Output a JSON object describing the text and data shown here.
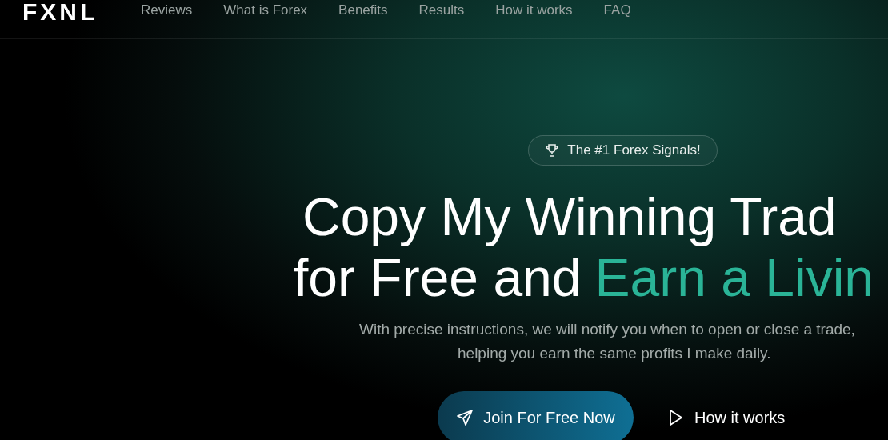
{
  "header": {
    "logo": "FXNL",
    "nav": [
      {
        "label": "Reviews"
      },
      {
        "label": "What is Forex"
      },
      {
        "label": "Benefits"
      },
      {
        "label": "Results"
      },
      {
        "label": "How it works"
      },
      {
        "label": "FAQ"
      }
    ]
  },
  "hero": {
    "badge": "The #1 Forex Signals!",
    "headline_line_1": "Copy My Winning Trad",
    "headline_line_2_plain": "for Free and",
    "headline_line_2_accent": "Earn a Livin",
    "subtitle_line_1": "With precise instructions, we will notify you when to open or close a trade,",
    "subtitle_line_2": "helping you earn the same profits I make daily.",
    "primary_button": "Join For Free Now",
    "secondary_button": "How it works"
  }
}
